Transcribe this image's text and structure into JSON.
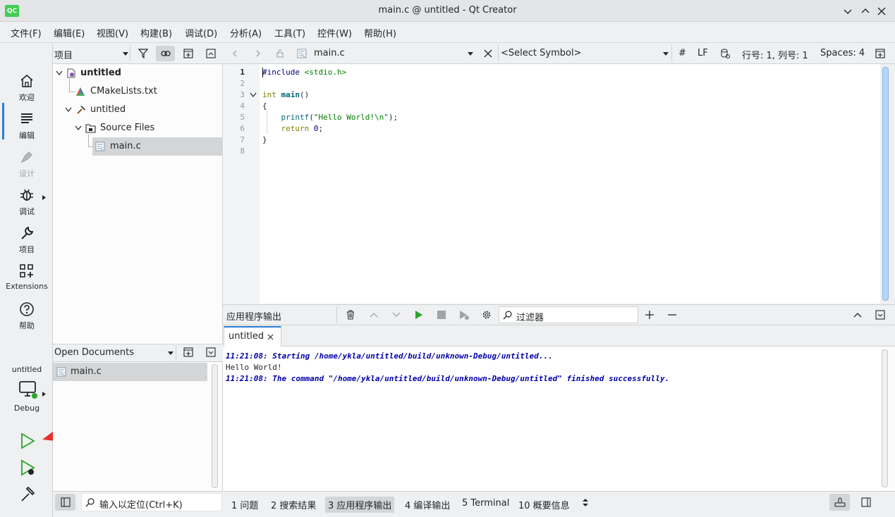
{
  "window": {
    "logo": "QC",
    "title": "main.c @ untitled - Qt Creator"
  },
  "menu": [
    "文件(F)",
    "编辑(E)",
    "视图(V)",
    "构建(B)",
    "调试(D)",
    "分析(A)",
    "工具(T)",
    "控件(W)",
    "帮助(H)"
  ],
  "modes": [
    {
      "label": "欢迎",
      "icon": "home-icon"
    },
    {
      "label": "编辑",
      "icon": "edit-document-icon",
      "active": true
    },
    {
      "label": "设计",
      "icon": "pen-icon",
      "disabled": true
    },
    {
      "label": "调试",
      "icon": "bug-icon"
    },
    {
      "label": "项目",
      "icon": "wrench-icon"
    },
    {
      "label": "Extensions",
      "icon": "extensions-icon"
    },
    {
      "label": "帮助",
      "icon": "help-icon"
    }
  ],
  "kit": {
    "project": "untitled",
    "config": "Debug"
  },
  "project_panel": {
    "view_selector": "项目",
    "tree": [
      "untitled",
      "CMakeLists.txt",
      "untitled",
      "Source Files",
      "main.c"
    ]
  },
  "open_documents": {
    "title": "Open Documents",
    "items": [
      "main.c"
    ]
  },
  "editor": {
    "file": "main.c",
    "symbol": "<Select Symbol>",
    "hash": "#",
    "line_ending": "LF",
    "position": "行号: 1, 列号: 1",
    "indent": "Spaces: 4",
    "line_numbers": [
      "1",
      "2",
      "3",
      "4",
      "5",
      "6",
      "7",
      "8"
    ],
    "code": {
      "l1_pp": "#include",
      "l1_hdr": "<stdio.h>",
      "l3_kw": "int",
      "l3_fn": "main",
      "l3_rest": "()",
      "l4": "{",
      "l5_fn": "printf",
      "l5_open": "(",
      "l5_str": "\"Hello World!\\n\"",
      "l5_close": ");",
      "l6_kw": "return",
      "l6_num": "0",
      "l6_end": ";",
      "l7": "}"
    }
  },
  "output": {
    "title": "应用程序输出",
    "filter_placeholder": "过滤器",
    "tab": "untitled",
    "lines": [
      "11:21:08: Starting /home/ykla/untitled/build/unknown-Debug/untitled...",
      "Hello World!",
      "11:21:08: The command \"/home/ykla/untitled/build/unknown-Debug/untitled\" finished successfully."
    ]
  },
  "statusbar": {
    "locator_placeholder": "输入以定位(Ctrl+K)",
    "panes": [
      "1 问题",
      "2 搜索结果",
      "3 应用程序输出",
      "4 编译输出",
      "5 Terminal",
      "10 概要信息"
    ],
    "active_pane": "3 应用程序输出"
  },
  "colors": {
    "accent": "#2a7fd4",
    "run_green": "#2aa52a",
    "output_blue": "#0000aa"
  }
}
